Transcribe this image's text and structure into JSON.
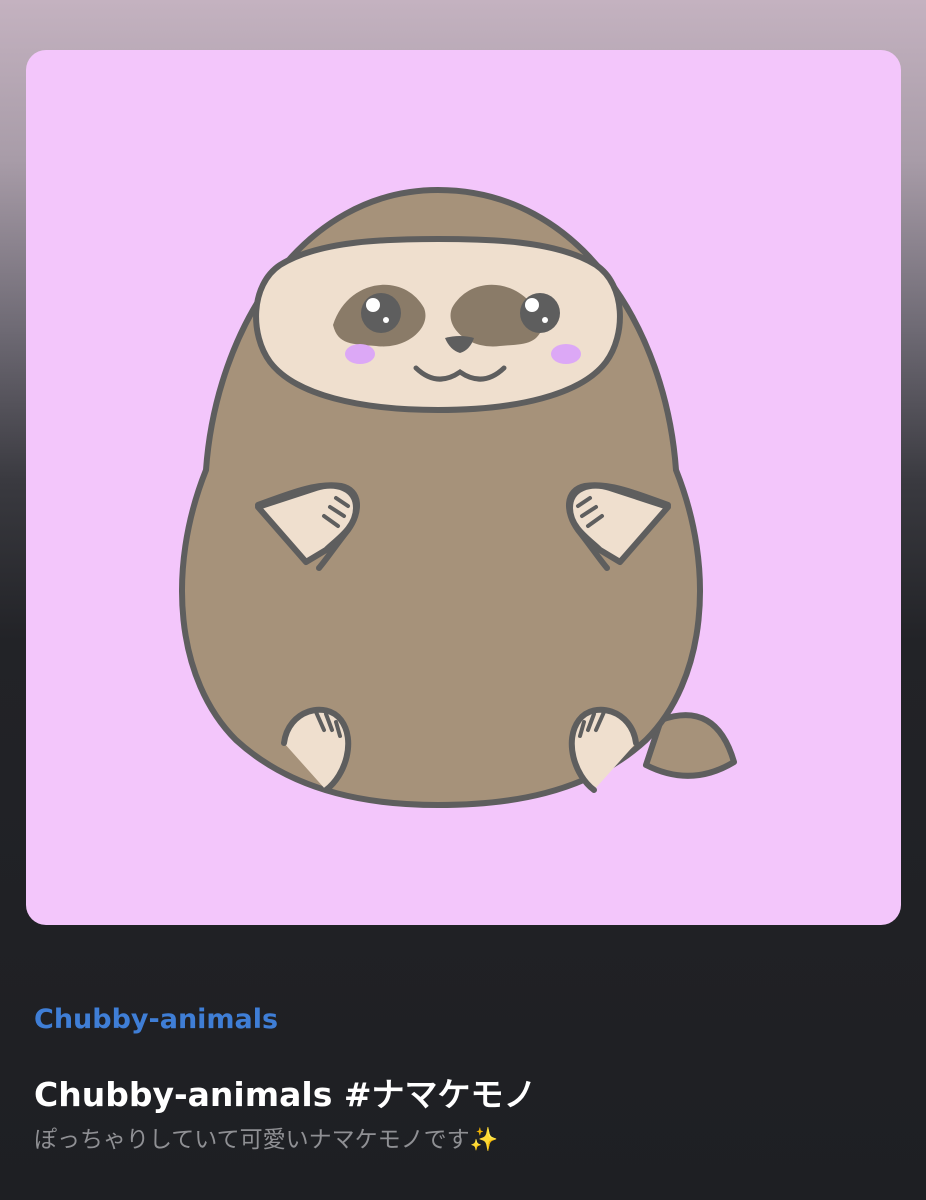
{
  "collection": {
    "name": "Chubby-animals"
  },
  "item": {
    "title": "Chubby-animals #ナマケモノ",
    "description": "ぽっちゃりしていて可愛いナマケモノです✨"
  },
  "artwork": {
    "subject": "sloth-illustration",
    "background_color": "#f3c6fb",
    "body_color": "#a6927a",
    "face_color": "#efdfce",
    "eye_patch_color": "#8a7b68",
    "outline_color": "#5e5e5e",
    "cheek_color": "#dca8f6"
  },
  "colors": {
    "link_accent": "#3f7ed6",
    "title_text": "#ffffff",
    "description_text": "#8f9094"
  }
}
